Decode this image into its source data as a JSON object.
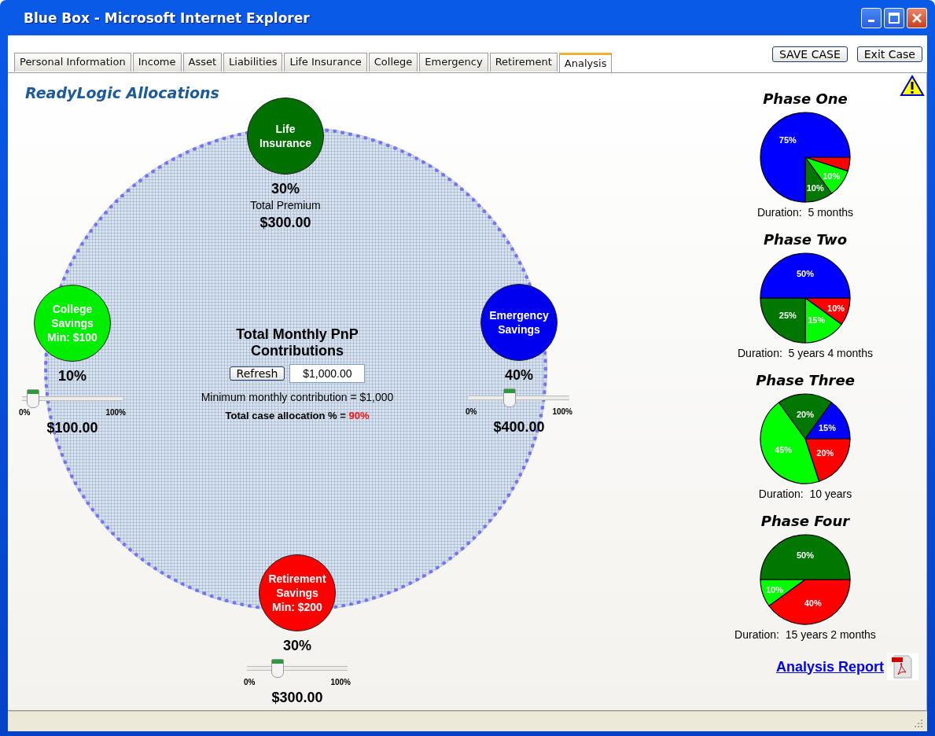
{
  "window": {
    "title": "Blue Box - Microsoft Internet Explorer"
  },
  "tabs": [
    {
      "label": "Personal Information",
      "selected": false
    },
    {
      "label": "Income",
      "selected": false
    },
    {
      "label": "Asset",
      "selected": false
    },
    {
      "label": "Liabilities",
      "selected": false
    },
    {
      "label": "Life Insurance",
      "selected": false
    },
    {
      "label": "College",
      "selected": false
    },
    {
      "label": "Emergency",
      "selected": false
    },
    {
      "label": "Retirement",
      "selected": false
    },
    {
      "label": "Analysis",
      "selected": true
    }
  ],
  "actions": [
    "SAVE CASE",
    "Exit Case"
  ],
  "heading": "ReadyLogic Allocations",
  "allocations": [
    {
      "kind": "premium",
      "lines": [
        "Life",
        "Insurance"
      ],
      "color": "#007000",
      "percent": "30%",
      "caption": "Total Premium",
      "amount": "$300.00"
    },
    {
      "kind": "slider",
      "lines": [
        "College",
        "Savings",
        "Min: $100"
      ],
      "color": "#00ee00",
      "percent": "10%",
      "level": 0.1,
      "min_label": "0%",
      "max_label": "100%",
      "amount": "$100.00"
    },
    {
      "kind": "slider",
      "lines": [
        "Emergency",
        "Savings"
      ],
      "color": "#0000ee",
      "percent": "40%",
      "level": 0.4,
      "min_label": "0%",
      "max_label": "100%",
      "amount": "$400.00"
    },
    {
      "kind": "slider",
      "lines": [
        "Retirement",
        "Savings",
        "Min: $200"
      ],
      "color": "#ff0000",
      "percent": "30%",
      "level": 0.3,
      "min_label": "0%",
      "max_label": "100%",
      "amount": "$300.00"
    }
  ],
  "contributions": {
    "title": "Total Monthly PnP Contributions",
    "refresh": "Refresh",
    "amount": "$1,000.00",
    "minimum": "Minimum monthly contribution = $1,000",
    "allocation_label": "Total case allocation % =",
    "allocation_value": "90%"
  },
  "phases": [
    {
      "title": "Phase One",
      "chart_data": {
        "type": "pie",
        "values": [
          5,
          10,
          10,
          75
        ],
        "colors": [
          "#ff0000",
          "#00ff00",
          "#007700",
          "#0000ff"
        ],
        "value_labels": [
          null,
          "10%",
          "10%",
          "75%"
        ]
      },
      "duration": "Duration:  5 months"
    },
    {
      "title": "Phase Two",
      "chart_data": {
        "type": "pie",
        "values": [
          10,
          15,
          25,
          50
        ],
        "colors": [
          "#ff0000",
          "#00ff00",
          "#007700",
          "#0000ff"
        ],
        "value_labels": [
          "10%",
          "15%",
          "25%",
          "50%"
        ]
      },
      "duration": "Duration:  5 years 4 months"
    },
    {
      "title": "Phase Three",
      "chart_data": {
        "type": "pie",
        "values": [
          20,
          45,
          20,
          15
        ],
        "colors": [
          "#ff0000",
          "#00ff00",
          "#007700",
          "#0000ff"
        ],
        "value_labels": [
          "20%",
          "45%",
          "20%",
          "15%"
        ]
      },
      "duration": "Duration:  10 years"
    },
    {
      "title": "Phase Four",
      "chart_data": {
        "type": "pie",
        "values": [
          40,
          10,
          50
        ],
        "colors": [
          "#ff0000",
          "#00ff00",
          "#007700"
        ],
        "value_labels": [
          "40%",
          "10%",
          "50%"
        ]
      },
      "duration": "Duration:  15 years 2 months"
    }
  ],
  "report_link": "Analysis Report"
}
